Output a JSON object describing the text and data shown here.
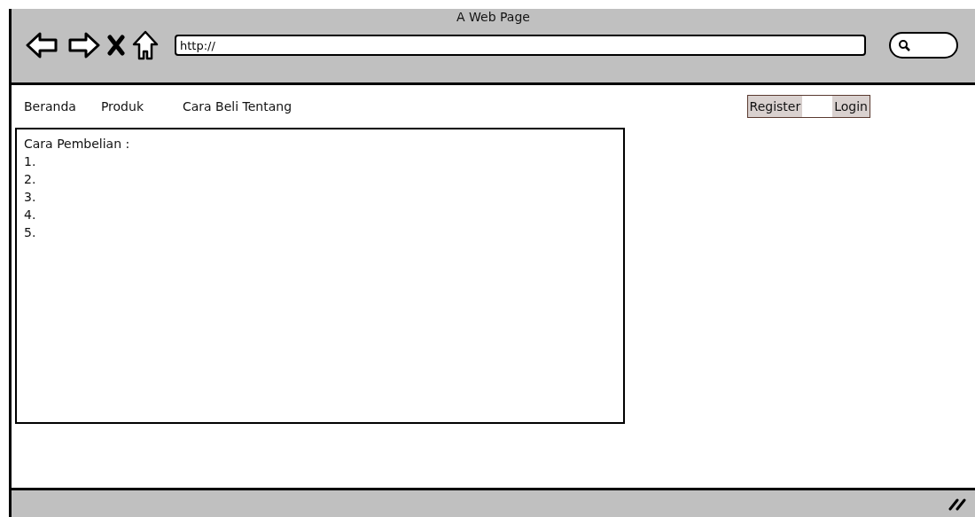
{
  "window": {
    "title": "A Web Page"
  },
  "address_bar": {
    "value": "http://"
  },
  "nav": [
    {
      "label": "Beranda"
    },
    {
      "label": "Produk"
    },
    {
      "label": "Cara Beli Tentang"
    }
  ],
  "auth_buttons": [
    {
      "label": "Register"
    },
    {
      "label": "Login"
    }
  ],
  "content": {
    "heading": "Cara Pembelian :",
    "items": [
      "1.",
      "2.",
      "3.",
      "4.",
      "5."
    ]
  }
}
